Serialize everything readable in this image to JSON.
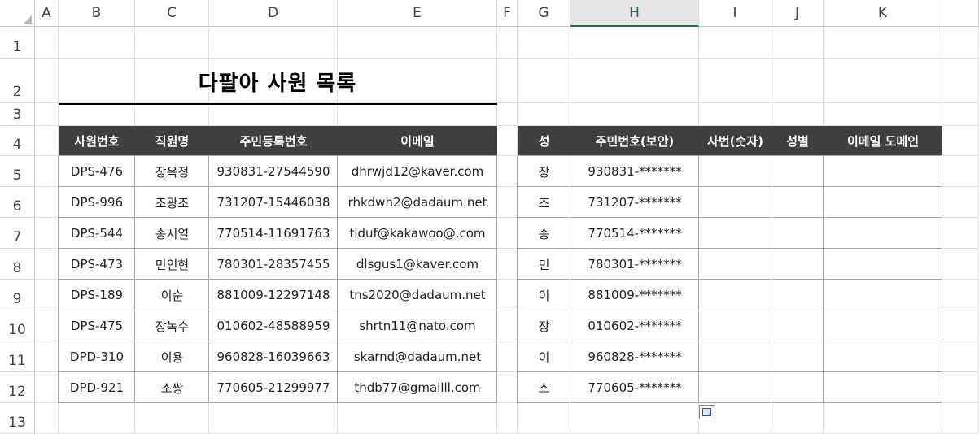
{
  "columns": [
    "A",
    "B",
    "C",
    "D",
    "E",
    "F",
    "G",
    "H",
    "I",
    "J",
    "K"
  ],
  "selected_column": "H",
  "rows": [
    "1",
    "2",
    "3",
    "4",
    "5",
    "6",
    "7",
    "8",
    "9",
    "10",
    "11",
    "12",
    "13"
  ],
  "title": "다팔아 사원 목록",
  "left_table": {
    "headers": [
      "사원번호",
      "직원명",
      "주민등록번호",
      "이메일"
    ],
    "rows": [
      [
        "DPS-476",
        "장옥정",
        "930831-27544590",
        "dhrwjd12@kaver.com"
      ],
      [
        "DPS-996",
        "조광조",
        "731207-15446038",
        "rhkdwh2@dadaum.net"
      ],
      [
        "DPS-544",
        "송시열",
        "770514-11691763",
        "tlduf@kakawoo@.com"
      ],
      [
        "DPS-473",
        "민인현",
        "780301-28357455",
        "dlsgus1@kaver.com"
      ],
      [
        "DPS-189",
        "이순",
        "881009-12297148",
        "tns2020@dadaum.net"
      ],
      [
        "DPS-475",
        "장녹수",
        "010602-48588959",
        "shrtn11@nato.com"
      ],
      [
        "DPD-310",
        "이용",
        "960828-16039663",
        "skarnd@dadaum.net"
      ],
      [
        "DPD-921",
        "소쌍",
        "770605-21299977",
        "thdb77@gmailll.com"
      ]
    ]
  },
  "right_table": {
    "headers": [
      "성",
      "주민번호(보안)",
      "사번(숫자)",
      "성별",
      "이메일 도메인"
    ],
    "rows": [
      [
        "장",
        "930831-*******",
        "",
        "",
        ""
      ],
      [
        "조",
        "731207-*******",
        "",
        "",
        ""
      ],
      [
        "송",
        "770514-*******",
        "",
        "",
        ""
      ],
      [
        "민",
        "780301-*******",
        "",
        "",
        ""
      ],
      [
        "이",
        "881009-*******",
        "",
        "",
        ""
      ],
      [
        "장",
        "010602-*******",
        "",
        "",
        ""
      ],
      [
        "이",
        "960828-*******",
        "",
        "",
        ""
      ],
      [
        "소",
        "770605-*******",
        "",
        "",
        ""
      ]
    ]
  },
  "colors": {
    "header_bg": "#3f3f3f",
    "header_text": "#ffffff",
    "selected_accent": "#217346"
  },
  "icons": {
    "paste_options": "paste-options-icon"
  }
}
